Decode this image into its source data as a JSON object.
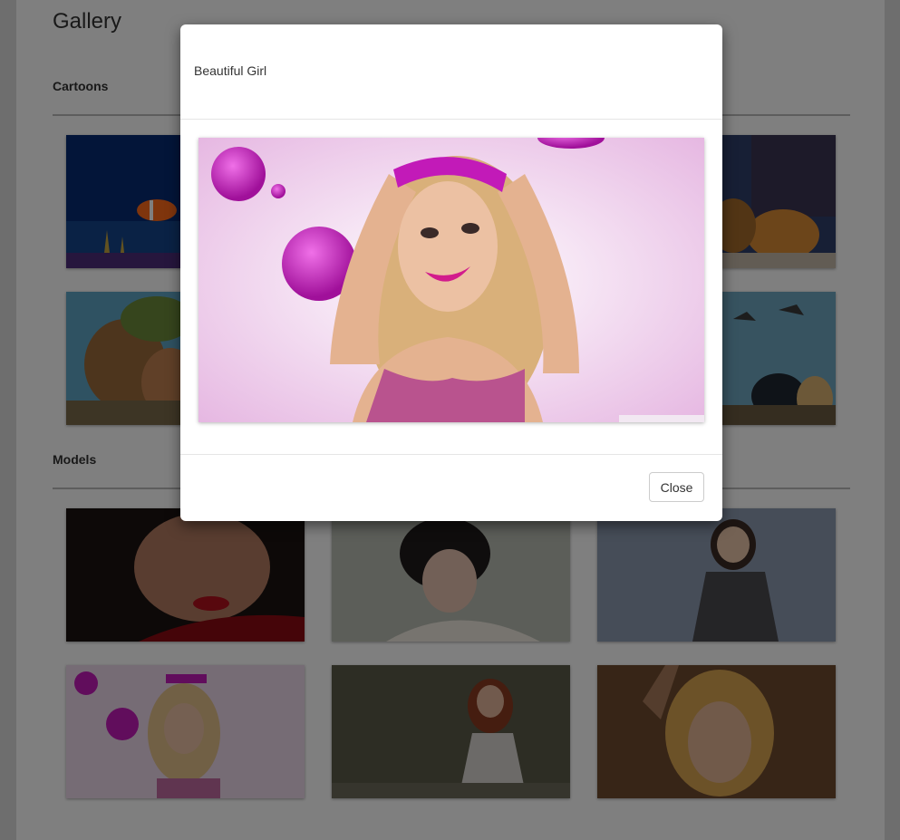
{
  "page": {
    "title": "Gallery"
  },
  "sections": [
    {
      "title": "Cartoons",
      "images": [
        "finding-nemo",
        "cartoon-2",
        "lady-and-the-tramp",
        "the-croods",
        "cartoon-5",
        "how-to-train-your-dragon"
      ]
    },
    {
      "title": "Models",
      "images": [
        "model-red-lips",
        "model-short-hair",
        "model-sunglasses",
        "model-pink-bubbles",
        "model-redhead",
        "model-blonde"
      ]
    }
  ],
  "modal": {
    "title": "Beautiful Girl",
    "close_label": "Close"
  },
  "colors": {
    "backdrop": "rgba(0,0,0,0.5)",
    "accent_pink": "#c21ab8"
  }
}
